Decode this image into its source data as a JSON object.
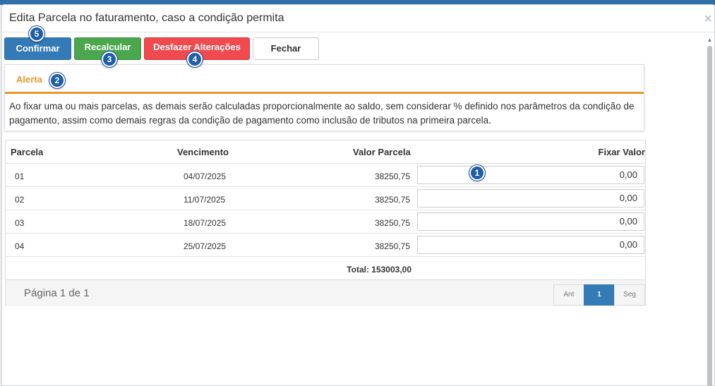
{
  "dialog": {
    "title": "Edita Parcela no faturamento, caso a condição permita",
    "close_symbol": "×"
  },
  "toolbar": {
    "confirm_label": "Confirmar",
    "recalc_label": "Recalcular",
    "undo_label": "Desfazer Alterações",
    "close_label": "Fechar"
  },
  "markers": [
    "1",
    "2",
    "3",
    "4",
    "5"
  ],
  "alert": {
    "title": "Alerta",
    "text": "Ao fixar uma ou mais parcelas, as demais serão calculadas proporcionalmente ao saldo, sem considerar % definido nos parâmetros da condição de pagamento, assim como demais regras da condição de pagamento como inclusão de tributos na primeira parcela."
  },
  "table": {
    "columns": [
      "Parcela",
      "Vencimento",
      "Valor Parcela",
      "Fixar Valor"
    ],
    "rows": [
      {
        "parcela": "01",
        "vencimento": "04/07/2025",
        "valor": "38250,75",
        "fixar": "0,00"
      },
      {
        "parcela": "02",
        "vencimento": "11/07/2025",
        "valor": "38250,75",
        "fixar": "0,00"
      },
      {
        "parcela": "03",
        "vencimento": "18/07/2025",
        "valor": "38250,75",
        "fixar": "0,00"
      },
      {
        "parcela": "04",
        "vencimento": "25/07/2025",
        "valor": "38250,75",
        "fixar": "0,00"
      }
    ],
    "total": "Total: 153003,00"
  },
  "pagination": {
    "info": "Página 1 de 1",
    "prev": "Ant",
    "current": "1",
    "next": "Seg"
  },
  "colors": {
    "primary": "#337ab7",
    "success": "#4aa74e",
    "danger": "#f04a4f",
    "alert_accent": "#e8962a",
    "marker": "#1f5ea8"
  }
}
